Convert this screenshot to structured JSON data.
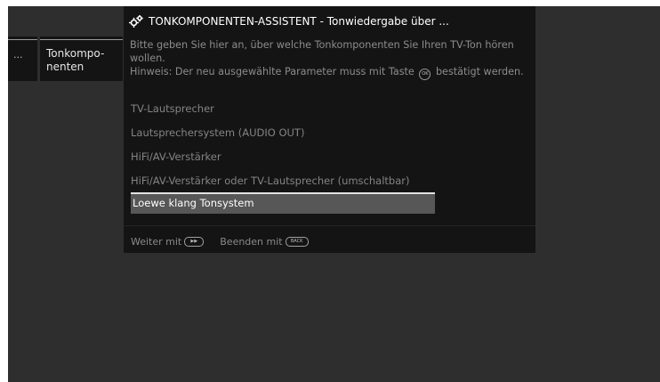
{
  "nav": {
    "prev_label": "...",
    "current_label": "Tonkompo-nenten"
  },
  "dialog": {
    "title_icon": "gears-icon",
    "title": "TONKOMPONENTEN-ASSISTENT - Tonwiedergabe über ...",
    "intro": "Bitte geben Sie hier an, über welche Tonkomponenten Sie Ihren TV-Ton hören wollen.",
    "hint_before": "Hinweis: Der neu ausgewählte Parameter muss mit Taste",
    "hint_key": "OK",
    "hint_after": "bestätigt werden.",
    "options": [
      {
        "label": "TV-Lautsprecher",
        "selected": false
      },
      {
        "label": "Lautsprechersystem (AUDIO OUT)",
        "selected": false
      },
      {
        "label": "HiFi/AV-Verstärker",
        "selected": false
      },
      {
        "label": "HiFi/AV-Verstärker oder TV-Lautsprecher (umschaltbar)",
        "selected": false
      },
      {
        "label": "Loewe klang Tonsystem",
        "selected": true
      }
    ],
    "footer": {
      "next_label": "Weiter mit",
      "next_key": "▶▶",
      "exit_label": "Beenden mit",
      "exit_key": "BACK"
    }
  },
  "colors": {
    "screen_bg": "#2e2e2e",
    "panel_bg": "#141414",
    "selected_bg": "#575757",
    "text_dim": "#8c8c8c",
    "text_bright": "#ffffff"
  }
}
